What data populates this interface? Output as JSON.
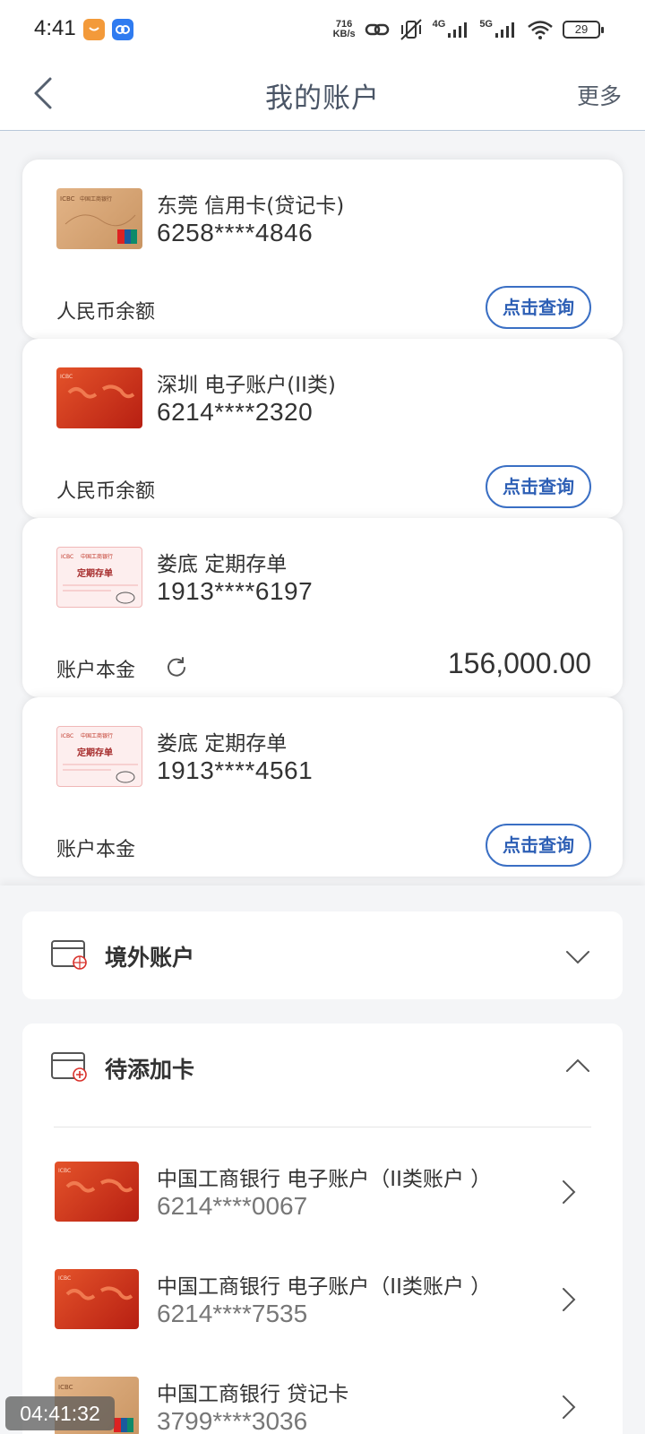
{
  "status_bar": {
    "time": "4:41",
    "speed_value": "716",
    "speed_unit": "KB/s",
    "net1": "4G",
    "net2": "5G",
    "battery": "29"
  },
  "header": {
    "title": "我的账户",
    "more": "更多"
  },
  "cards": [
    {
      "name": "东莞 信用卡(贷记卡)",
      "number": "6258****4846",
      "balance_label": "人民币余额",
      "action": "点击查询",
      "style": "gold"
    },
    {
      "name": "深圳 电子账户(II类)",
      "number": "6214****2320",
      "balance_label": "人民币余额",
      "action": "点击查询",
      "style": "red"
    },
    {
      "name": "娄底 定期存单",
      "number": "1913****6197",
      "balance_label": "账户本金",
      "amount": "156,000.00",
      "style": "deposit"
    },
    {
      "name": "娄底 定期存单",
      "number": "1913****4561",
      "balance_label": "账户本金",
      "action": "点击查询",
      "style": "deposit"
    }
  ],
  "thumb_text": {
    "icbc": "ICBC",
    "bank_short": "中国工商银行",
    "deposit": "定期存单"
  },
  "sections": {
    "overseas": {
      "title": "境外账户"
    },
    "pending": {
      "title": "待添加卡"
    }
  },
  "pending_cards": [
    {
      "name": "中国工商银行 电子账户（II类账户 ）",
      "number": "6214****0067",
      "style": "red"
    },
    {
      "name": "中国工商银行 电子账户（II类账户 ）",
      "number": "6214****7535",
      "style": "red"
    },
    {
      "name": "中国工商银行 贷记卡",
      "number": "3799****3036",
      "style": "gold"
    }
  ],
  "overlay_timestamp": "04:41:32",
  "colors": {
    "accent_blue": "#2d5fb5",
    "icbc_red": "#c8291a",
    "card_gold": "#d9a877"
  }
}
